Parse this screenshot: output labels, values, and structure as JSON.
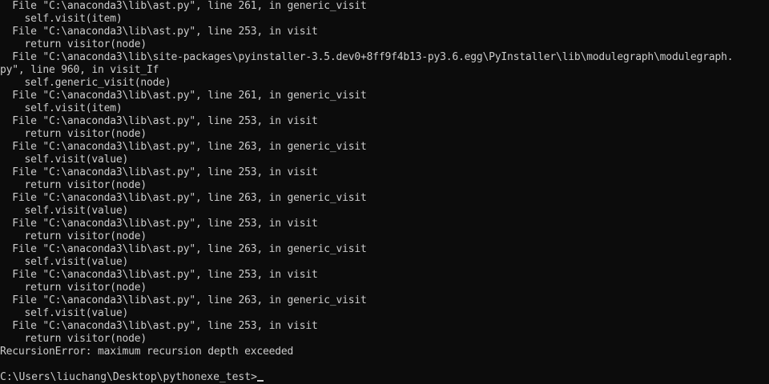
{
  "terminal": {
    "lines": [
      "  File \"C:\\anaconda3\\lib\\ast.py\", line 261, in generic_visit",
      "    self.visit(item)",
      "  File \"C:\\anaconda3\\lib\\ast.py\", line 253, in visit",
      "    return visitor(node)",
      "  File \"C:\\anaconda3\\lib\\site-packages\\pyinstaller-3.5.dev0+8ff9f4b13-py3.6.egg\\PyInstaller\\lib\\modulegraph\\modulegraph.",
      "py\", line 960, in visit_If",
      "    self.generic_visit(node)",
      "  File \"C:\\anaconda3\\lib\\ast.py\", line 261, in generic_visit",
      "    self.visit(item)",
      "  File \"C:\\anaconda3\\lib\\ast.py\", line 253, in visit",
      "    return visitor(node)",
      "  File \"C:\\anaconda3\\lib\\ast.py\", line 263, in generic_visit",
      "    self.visit(value)",
      "  File \"C:\\anaconda3\\lib\\ast.py\", line 253, in visit",
      "    return visitor(node)",
      "  File \"C:\\anaconda3\\lib\\ast.py\", line 263, in generic_visit",
      "    self.visit(value)",
      "  File \"C:\\anaconda3\\lib\\ast.py\", line 253, in visit",
      "    return visitor(node)",
      "  File \"C:\\anaconda3\\lib\\ast.py\", line 263, in generic_visit",
      "    self.visit(value)",
      "  File \"C:\\anaconda3\\lib\\ast.py\", line 253, in visit",
      "    return visitor(node)",
      "  File \"C:\\anaconda3\\lib\\ast.py\", line 263, in generic_visit",
      "    self.visit(value)",
      "  File \"C:\\anaconda3\\lib\\ast.py\", line 253, in visit",
      "    return visitor(node)",
      "RecursionError: maximum recursion depth exceeded"
    ],
    "prompt": "C:\\Users\\liuchang\\Desktop\\pythonexe_test>"
  },
  "colors": {
    "background": "#0c0c0c",
    "text": "#cccccc"
  }
}
